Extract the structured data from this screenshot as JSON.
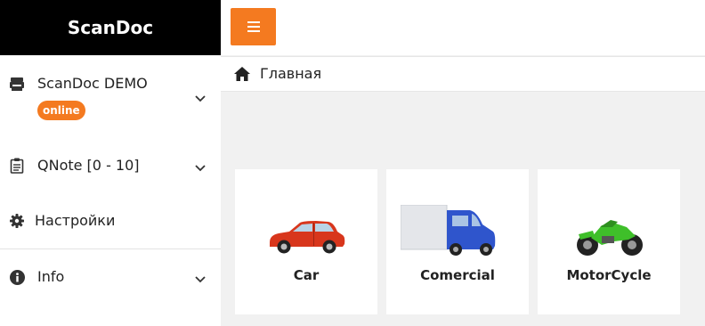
{
  "app": {
    "brand": "ScanDoc"
  },
  "sidebar": {
    "items": [
      {
        "label": "ScanDoc DEMO",
        "badge": "online"
      },
      {
        "label": "QNote [0 - 10]"
      },
      {
        "label": "Настройки"
      },
      {
        "label": "Info"
      }
    ]
  },
  "breadcrumb": {
    "current": "Главная"
  },
  "cards": [
    {
      "label": "Car"
    },
    {
      "label": "Comercial"
    },
    {
      "label": "MotorCycle"
    }
  ],
  "colors": {
    "accent": "#f47a20",
    "brand_bg": "#000000"
  }
}
